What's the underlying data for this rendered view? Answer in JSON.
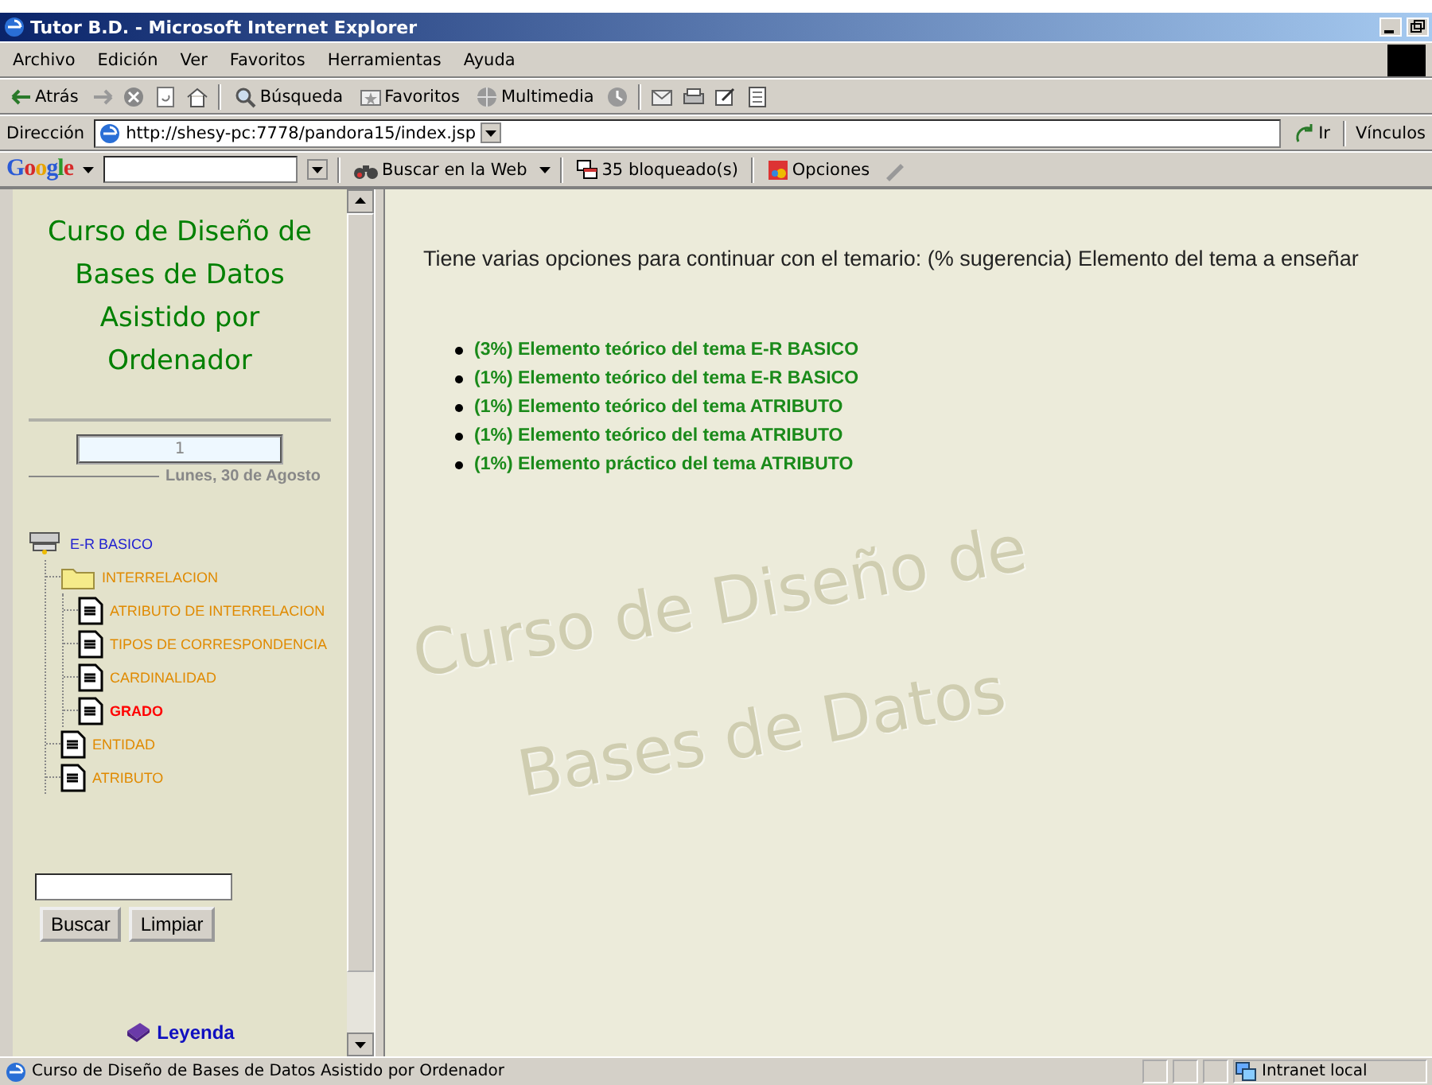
{
  "window": {
    "title": "Tutor B.D. - Microsoft Internet Explorer"
  },
  "menu": [
    "Archivo",
    "Edición",
    "Ver",
    "Favoritos",
    "Herramientas",
    "Ayuda"
  ],
  "toolbar": [
    {
      "kind": "back",
      "label": "Atrás"
    },
    {
      "kind": "forward"
    },
    {
      "kind": "stop"
    },
    {
      "kind": "refresh"
    },
    {
      "kind": "home"
    },
    {
      "kind": "search",
      "label": "Búsqueda"
    },
    {
      "kind": "favorites",
      "label": "Favoritos"
    },
    {
      "kind": "media",
      "label": "Multimedia"
    },
    {
      "kind": "history"
    },
    {
      "kind": "mail"
    },
    {
      "kind": "print"
    },
    {
      "kind": "edit"
    },
    {
      "kind": "notes"
    }
  ],
  "address": {
    "label": "Dirección",
    "url": "http://shesy-pc:7778/pandora15/index.jsp",
    "go": "Ir",
    "links": "Vínculos"
  },
  "google_bar": {
    "logo": "Google",
    "search_button": "Buscar en la Web",
    "blocked": "35 bloqueado(s)",
    "options": "Opciones"
  },
  "sidebar": {
    "title_lines": [
      "Curso de Diseño de",
      "Bases de Datos",
      "Asistido por",
      "Ordenador"
    ],
    "page_field": "1",
    "date": "Lunes, 30 de Agosto",
    "tree": {
      "label": "E-R BASICO",
      "kind": "root",
      "selected": false,
      "children": [
        {
          "label": "INTERRELACION",
          "kind": "folder",
          "selected": false,
          "children": [
            {
              "label": "ATRIBUTO DE INTERRELACION",
              "kind": "document",
              "selected": false
            },
            {
              "label": "TIPOS DE CORRESPONDENCIA",
              "kind": "document",
              "selected": false
            },
            {
              "label": "CARDINALIDAD",
              "kind": "document",
              "selected": false
            },
            {
              "label": "GRADO",
              "kind": "document",
              "selected": true
            }
          ]
        },
        {
          "label": "ENTIDAD",
          "kind": "document",
          "selected": false
        },
        {
          "label": "ATRIBUTO",
          "kind": "document",
          "selected": false
        }
      ]
    },
    "search_buttons": [
      "Buscar",
      "Limpiar"
    ],
    "legend": "Leyenda"
  },
  "main": {
    "intro": "Tiene varias opciones para continuar con el temario: (% sugerencia) Elemento del tema a enseñar",
    "options": [
      "(3%) Elemento teórico del tema E-R BASICO",
      "(1%) Elemento teórico del tema E-R BASICO",
      "(1%) Elemento teórico del tema ATRIBUTO",
      "(1%) Elemento teórico del tema ATRIBUTO",
      "(1%) Elemento práctico del tema ATRIBUTO"
    ]
  },
  "background_text": [
    {
      "lines": [
        "Curso de Diseño de",
        "Bases de Datos"
      ]
    }
  ],
  "status_bar": {
    "text": "Curso de Diseño de Bases de Datos Asistido por Ordenador",
    "zone": "Intranet local"
  }
}
